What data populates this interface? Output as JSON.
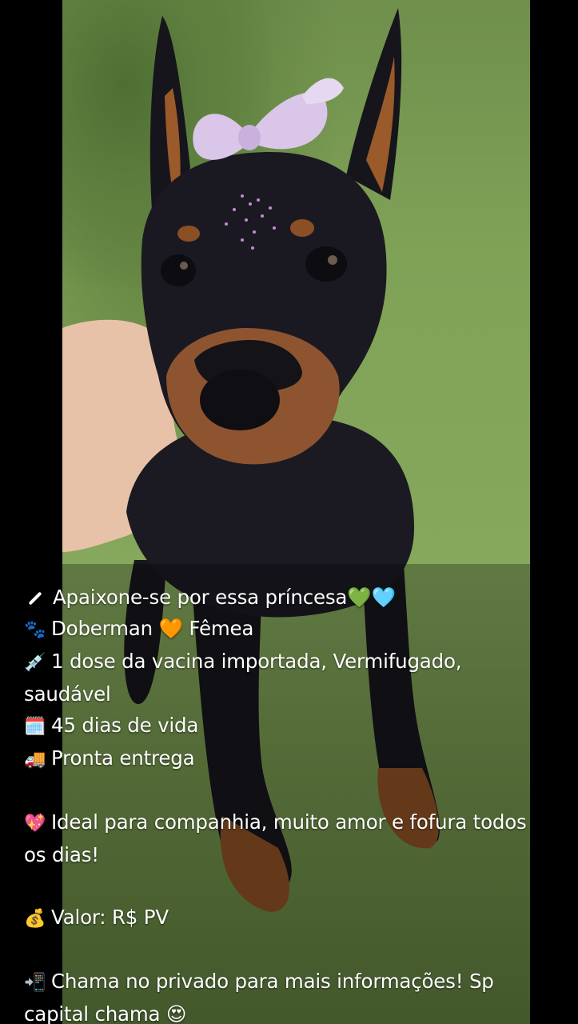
{
  "caption": {
    "line1": {
      "icon": "pencil-icon",
      "text": "Apaixone-se por essa príncesa💚🩵"
    },
    "line2": {
      "icon": "paw-prints-icon",
      "glyph": "🐾",
      "text": "Doberman 🧡 Fêmea"
    },
    "line3": {
      "icon": "syringe-icon",
      "glyph": "💉",
      "text": "1 dose da vacina importada, Vermifugado, saudável"
    },
    "line4": {
      "icon": "calendar-icon",
      "glyph": "🗓️",
      "text": "45 dias de vida"
    },
    "line5": {
      "icon": "truck-icon",
      "glyph": "🚚",
      "text": "Pronta entrega"
    },
    "line6": {
      "icon": "heart-icon",
      "glyph": "💖",
      "text": "Ideal para companhia, muito amor e fofura todos os dias!"
    },
    "line7": {
      "icon": "money-bag-icon",
      "glyph": "💰",
      "text": "Valor: R$ PV"
    },
    "line8": {
      "icon": "phone-arrow-icon",
      "glyph": "📲",
      "text": "Chama no privado para mais informações! Sp capital chama 😍"
    }
  },
  "colors": {
    "background": "#000000",
    "grass": "#7fa257",
    "dog_black": "#15141c",
    "dog_tan": "#9a5a2a",
    "bow": "#d9c6e8",
    "text": "#ffffff"
  }
}
